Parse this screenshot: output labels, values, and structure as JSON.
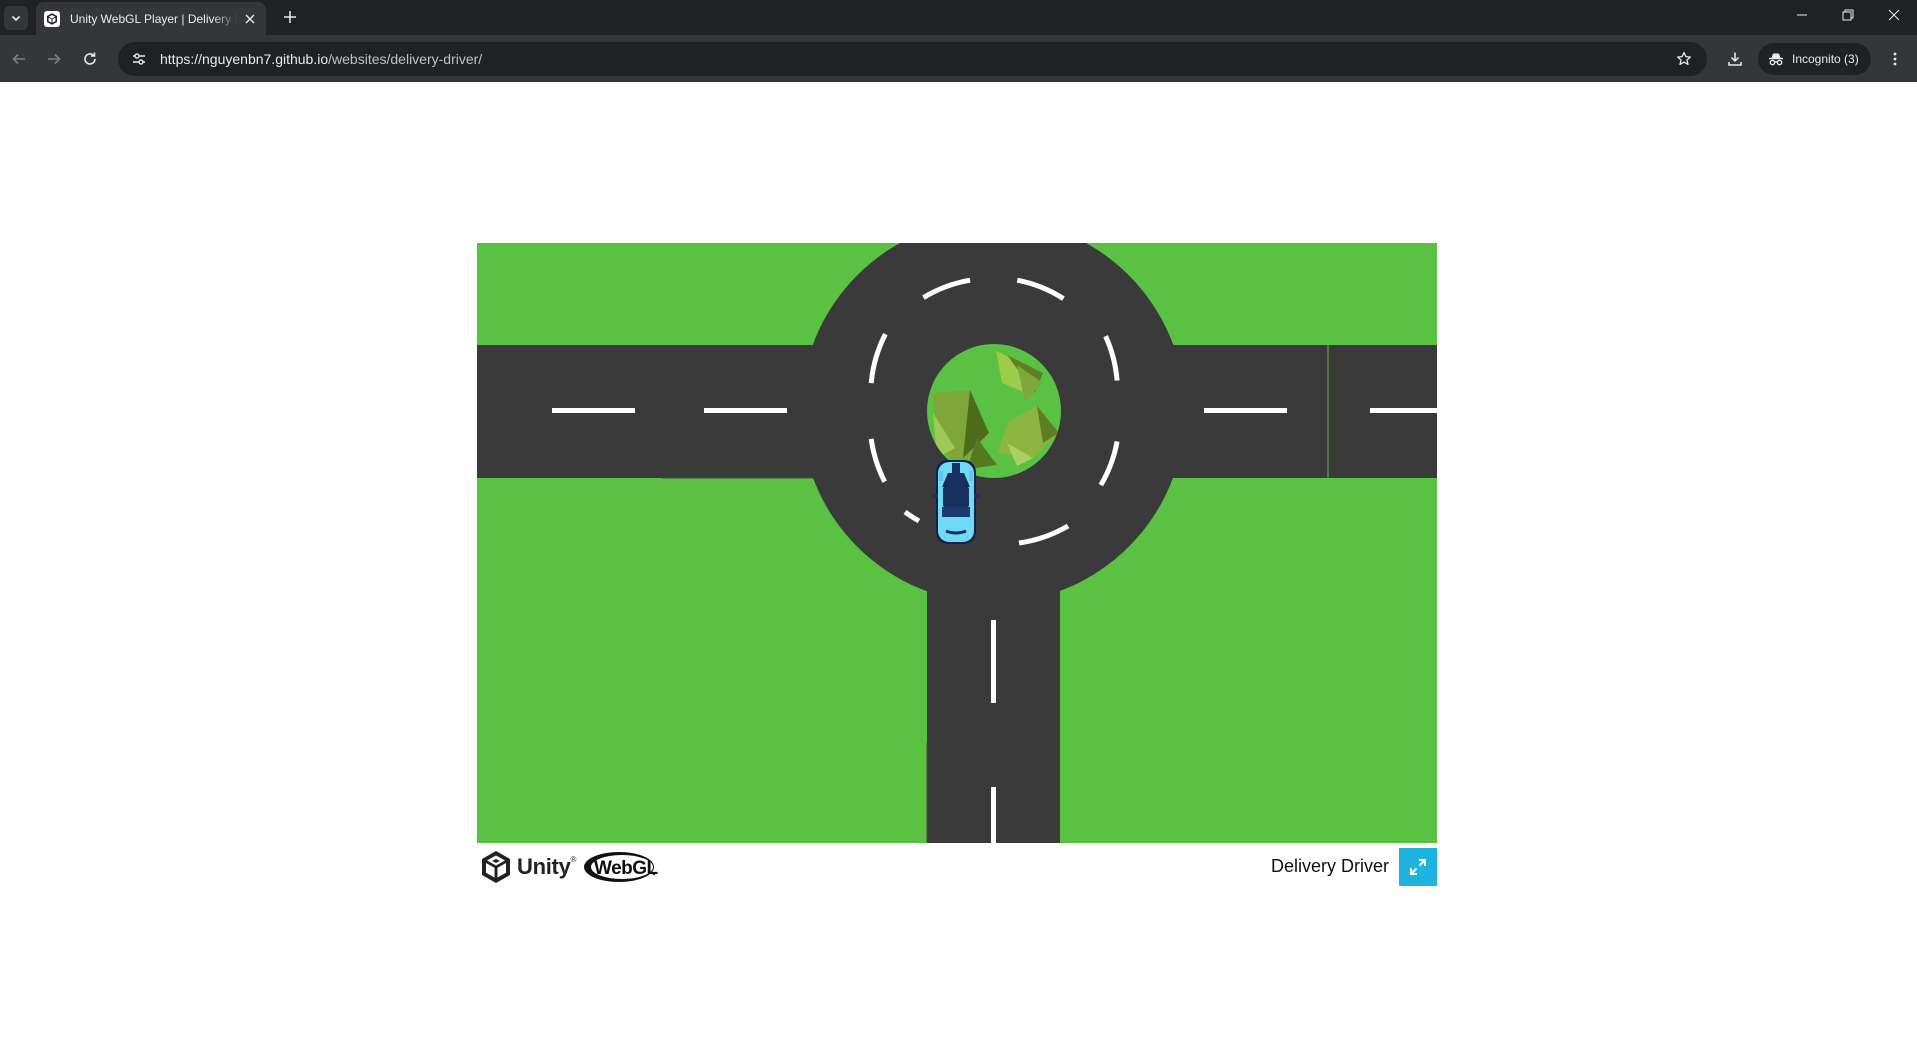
{
  "browser": {
    "tab_title": "Unity WebGL Player | Delivery Driver",
    "url_host": "https://nguyenbn7.github.io",
    "url_path": "/websites/delivery-driver/",
    "incognito_label": "Incognito (3)"
  },
  "player": {
    "engine_label": "Unity",
    "engine_tm": "®",
    "webgl_label": "WebGL",
    "build_title": "Delivery Driver"
  },
  "colors": {
    "grass": "#5ac142",
    "road": "#3a3a3b",
    "lane_marking": "#ffffff",
    "car_body": "#6fd9f6",
    "car_roof": "#17305e",
    "fullscreen_button": "#1fb4e0"
  },
  "icons": {
    "tab_search": "chevron-down-icon",
    "favicon": "unity-icon",
    "tab_close": "close-icon",
    "new_tab": "plus-icon",
    "back": "arrow-left-icon",
    "forward": "arrow-right-icon",
    "reload": "reload-icon",
    "site_info": "tune-icon",
    "bookmark": "star-icon",
    "download": "download-icon",
    "incognito": "incognito-icon",
    "menu": "kebab-menu-icon",
    "fullscreen": "fullscreen-icon"
  }
}
